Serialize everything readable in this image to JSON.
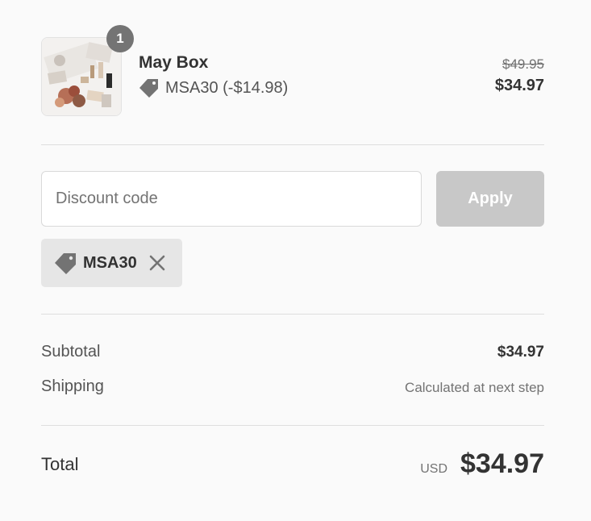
{
  "product": {
    "name": "May Box",
    "quantity": "1",
    "discount_label": "MSA30 (-$14.98)",
    "original_price": "$49.95",
    "price": "$34.97",
    "thumbnail_icon": "product-photo"
  },
  "discount": {
    "placeholder": "Discount code",
    "value": "",
    "apply_label": "Apply",
    "applied_code": "MSA30",
    "tag_icon": "tag-icon",
    "remove_icon": "close-icon"
  },
  "summary": {
    "subtotal_label": "Subtotal",
    "subtotal_value": "$34.97",
    "shipping_label": "Shipping",
    "shipping_value": "Calculated at next step",
    "total_label": "Total",
    "currency": "USD",
    "total_value": "$34.97"
  },
  "colors": {
    "background": "#fafafa",
    "badge": "#747474",
    "apply_disabled": "#c8c8c8",
    "chip": "#e6e6e6",
    "text": "#333333"
  }
}
